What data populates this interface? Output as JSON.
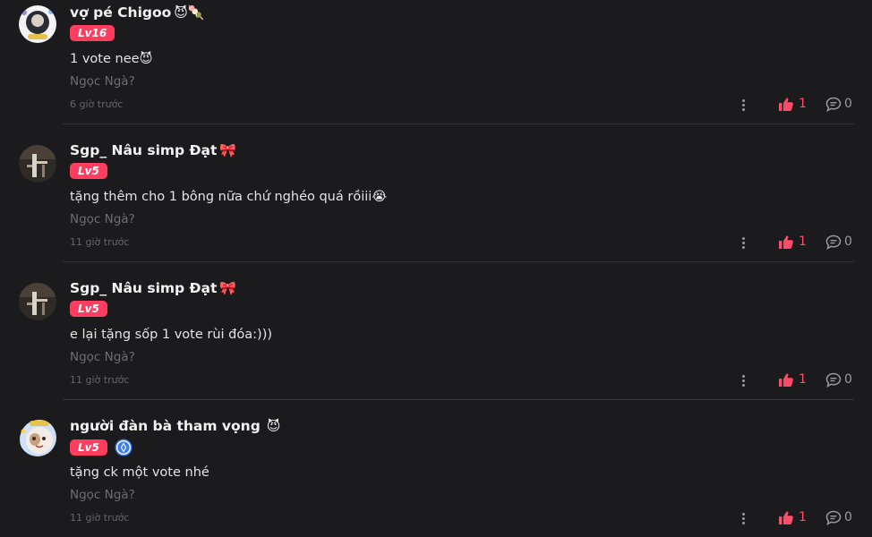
{
  "accent_color": "#ff3d5e",
  "comments": [
    {
      "username": "vợ pé Chigoo",
      "name_emojis": "😈🍡",
      "level": "Lv16",
      "verified": false,
      "text": "1 vote nee😈",
      "reply_to": "Ngọc Ngà?",
      "time": "6 giờ trước",
      "likes": "1",
      "replies": "0",
      "icons": {
        "like": "thumbs-up-icon",
        "reply": "comment-bubble-icon",
        "more": "more-vertical-icon"
      }
    },
    {
      "username": "Sgp_ Nâu simp Đạt",
      "name_emojis": "🎀",
      "level": "Lv5",
      "verified": false,
      "text": "tặng thêm cho 1 bông nữa chứ nghéo quá rồiii😭",
      "reply_to": "Ngọc Ngà?",
      "time": "11 giờ trước",
      "likes": "1",
      "replies": "0"
    },
    {
      "username": "Sgp_ Nâu simp Đạt",
      "name_emojis": "🎀",
      "level": "Lv5",
      "verified": false,
      "text": "e lại tặng sốp 1 vote rùi đóa:)))",
      "reply_to": "Ngọc Ngà?",
      "time": "11 giờ trước",
      "likes": "1",
      "replies": "0"
    },
    {
      "username": "người đàn bà tham vọng",
      "name_emojis": "😈",
      "level": "Lv5",
      "verified": true,
      "text": "tặng ck một vote nhé",
      "reply_to": "Ngọc Ngà?",
      "time": "11 giờ trước",
      "likes": "1",
      "replies": "0"
    }
  ]
}
